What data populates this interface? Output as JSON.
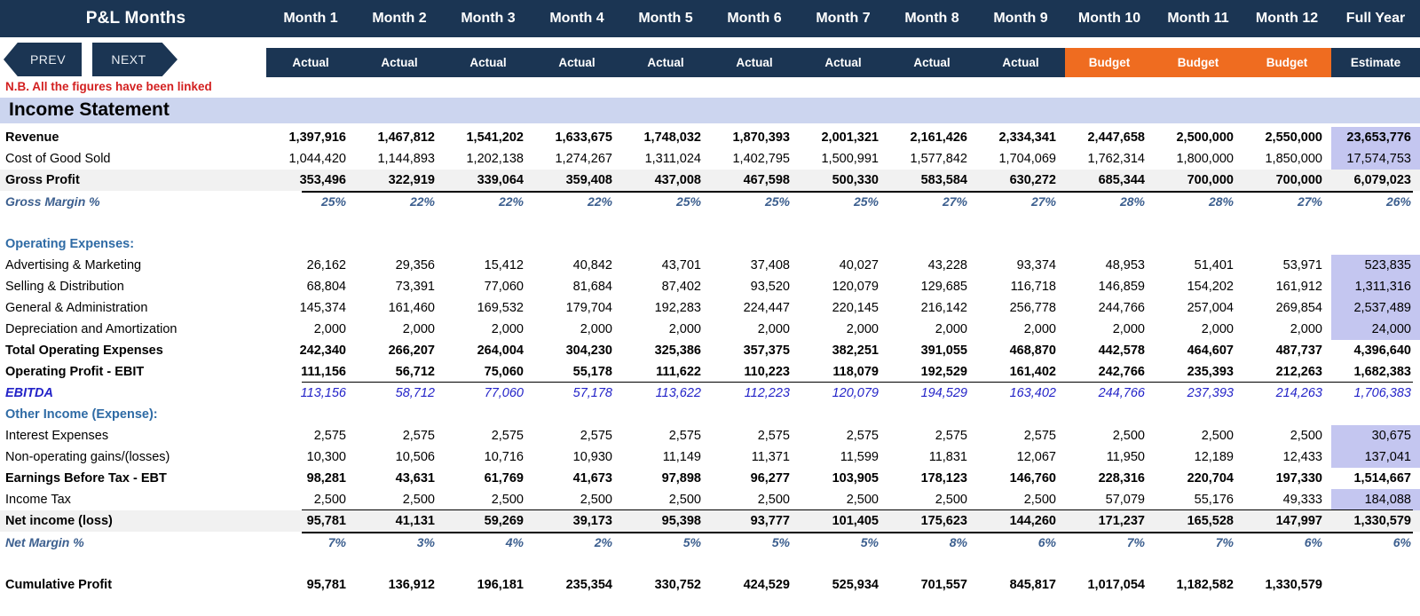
{
  "header": {
    "title": "P&L Months",
    "months": [
      "Month 1",
      "Month 2",
      "Month 3",
      "Month 4",
      "Month 5",
      "Month 6",
      "Month 7",
      "Month 8",
      "Month 9",
      "Month 10",
      "Month 11",
      "Month 12",
      "Full Year"
    ],
    "subheaders": [
      "Actual",
      "Actual",
      "Actual",
      "Actual",
      "Actual",
      "Actual",
      "Actual",
      "Actual",
      "Actual",
      "Budget",
      "Budget",
      "Budget",
      "Estimate"
    ],
    "subheader_types": [
      "actual",
      "actual",
      "actual",
      "actual",
      "actual",
      "actual",
      "actual",
      "actual",
      "actual",
      "budget",
      "budget",
      "budget",
      "estimate"
    ],
    "prev_label": "PREV",
    "next_label": "NEXT",
    "note": "N.B. All the figures have been linked",
    "navy": "#1b3553",
    "orange": "#ef6c20",
    "note_color": "#d32020"
  },
  "section": {
    "title": "Income Statement",
    "band_color": "#ccd5ef"
  },
  "rows": [
    {
      "label": "Revenue",
      "style": "bold",
      "highlight_last": true,
      "values": [
        "1,397,916",
        "1,467,812",
        "1,541,202",
        "1,633,675",
        "1,748,032",
        "1,870,393",
        "2,001,321",
        "2,161,426",
        "2,334,341",
        "2,447,658",
        "2,500,000",
        "2,550,000",
        "23,653,776"
      ]
    },
    {
      "label": "Cost of Good Sold",
      "style": "normal",
      "highlight_last": true,
      "values": [
        "1,044,420",
        "1,144,893",
        "1,202,138",
        "1,274,267",
        "1,311,024",
        "1,402,795",
        "1,500,991",
        "1,577,842",
        "1,704,069",
        "1,762,314",
        "1,800,000",
        "1,850,000",
        "17,574,753"
      ]
    },
    {
      "label": "Gross Profit",
      "style": "bold shade",
      "highlight_last": false,
      "values": [
        "353,496",
        "322,919",
        "339,064",
        "359,408",
        "437,008",
        "467,598",
        "500,330",
        "583,584",
        "630,272",
        "685,344",
        "700,000",
        "700,000",
        "6,079,023"
      ]
    },
    {
      "label": "Gross Margin %",
      "style": "pct topline",
      "highlight_last": false,
      "values": [
        "25%",
        "22%",
        "22%",
        "22%",
        "25%",
        "25%",
        "25%",
        "27%",
        "27%",
        "28%",
        "28%",
        "27%",
        "26%"
      ]
    },
    {
      "label": "",
      "style": "gap",
      "values": []
    },
    {
      "label": "Operating Expenses:",
      "style": "hdrblue",
      "values": []
    },
    {
      "label": "Advertising & Marketing",
      "style": "normal",
      "highlight_last": true,
      "values": [
        "26,162",
        "29,356",
        "15,412",
        "40,842",
        "43,701",
        "37,408",
        "40,027",
        "43,228",
        "93,374",
        "48,953",
        "51,401",
        "53,971",
        "523,835"
      ]
    },
    {
      "label": "Selling & Distribution",
      "style": "normal",
      "highlight_last": true,
      "values": [
        "68,804",
        "73,391",
        "77,060",
        "81,684",
        "87,402",
        "93,520",
        "120,079",
        "129,685",
        "116,718",
        "146,859",
        "154,202",
        "161,912",
        "1,311,316"
      ]
    },
    {
      "label": "General & Administration",
      "style": "normal",
      "highlight_last": true,
      "values": [
        "145,374",
        "161,460",
        "169,532",
        "179,704",
        "192,283",
        "224,447",
        "220,145",
        "216,142",
        "256,778",
        "244,766",
        "257,004",
        "269,854",
        "2,537,489"
      ]
    },
    {
      "label": "Depreciation and Amortization",
      "style": "normal",
      "highlight_last": true,
      "values": [
        "2,000",
        "2,000",
        "2,000",
        "2,000",
        "2,000",
        "2,000",
        "2,000",
        "2,000",
        "2,000",
        "2,000",
        "2,000",
        "2,000",
        "24,000"
      ]
    },
    {
      "label": "Total Operating Expenses",
      "style": "bold",
      "highlight_last": false,
      "values": [
        "242,340",
        "266,207",
        "264,004",
        "304,230",
        "325,386",
        "357,375",
        "382,251",
        "391,055",
        "468,870",
        "442,578",
        "464,607",
        "487,737",
        "4,396,640"
      ]
    },
    {
      "label": "Operating Profit - EBIT",
      "style": "bold botline",
      "highlight_last": false,
      "values": [
        "111,156",
        "56,712",
        "75,060",
        "55,178",
        "111,622",
        "110,223",
        "118,079",
        "192,529",
        "161,402",
        "242,766",
        "235,393",
        "212,263",
        "1,682,383"
      ]
    },
    {
      "label": "EBITDA",
      "style": "blue",
      "highlight_last": false,
      "values": [
        "113,156",
        "58,712",
        "77,060",
        "57,178",
        "113,622",
        "112,223",
        "120,079",
        "194,529",
        "163,402",
        "244,766",
        "237,393",
        "214,263",
        "1,706,383"
      ]
    },
    {
      "label": "Other Income (Expense):",
      "style": "hdrblue",
      "values": []
    },
    {
      "label": "Interest Expenses",
      "style": "normal",
      "highlight_last": true,
      "values": [
        "2,575",
        "2,575",
        "2,575",
        "2,575",
        "2,575",
        "2,575",
        "2,575",
        "2,575",
        "2,575",
        "2,500",
        "2,500",
        "2,500",
        "30,675"
      ]
    },
    {
      "label": "Non-operating gains/(losses)",
      "style": "normal",
      "highlight_last": true,
      "values": [
        "10,300",
        "10,506",
        "10,716",
        "10,930",
        "11,149",
        "11,371",
        "11,599",
        "11,831",
        "12,067",
        "11,950",
        "12,189",
        "12,433",
        "137,041"
      ]
    },
    {
      "label": "Earnings Before Tax - EBT",
      "style": "bold",
      "highlight_last": false,
      "values": [
        "98,281",
        "43,631",
        "61,769",
        "41,673",
        "97,898",
        "96,277",
        "103,905",
        "178,123",
        "146,760",
        "228,316",
        "220,704",
        "197,330",
        "1,514,667"
      ]
    },
    {
      "label": "Income Tax",
      "style": "normal botline",
      "highlight_last": true,
      "values": [
        "2,500",
        "2,500",
        "2,500",
        "2,500",
        "2,500",
        "2,500",
        "2,500",
        "2,500",
        "2,500",
        "57,079",
        "55,176",
        "49,333",
        "184,088"
      ]
    },
    {
      "label": "Net income (loss)",
      "style": "bold shade",
      "highlight_last": false,
      "values": [
        "95,781",
        "41,131",
        "59,269",
        "39,173",
        "95,398",
        "93,777",
        "101,405",
        "175,623",
        "144,260",
        "171,237",
        "165,528",
        "147,997",
        "1,330,579"
      ]
    },
    {
      "label": "Net Margin %",
      "style": "pct topline",
      "highlight_last": false,
      "values": [
        "7%",
        "3%",
        "4%",
        "2%",
        "5%",
        "5%",
        "5%",
        "8%",
        "6%",
        "7%",
        "7%",
        "6%",
        "6%"
      ]
    },
    {
      "label": "",
      "style": "gap",
      "values": []
    },
    {
      "label": "Cumulative Profit",
      "style": "bold",
      "highlight_last": false,
      "values": [
        "95,781",
        "136,912",
        "196,181",
        "235,354",
        "330,752",
        "424,529",
        "525,934",
        "701,557",
        "845,817",
        "1,017,054",
        "1,182,582",
        "1,330,579",
        ""
      ]
    }
  ]
}
